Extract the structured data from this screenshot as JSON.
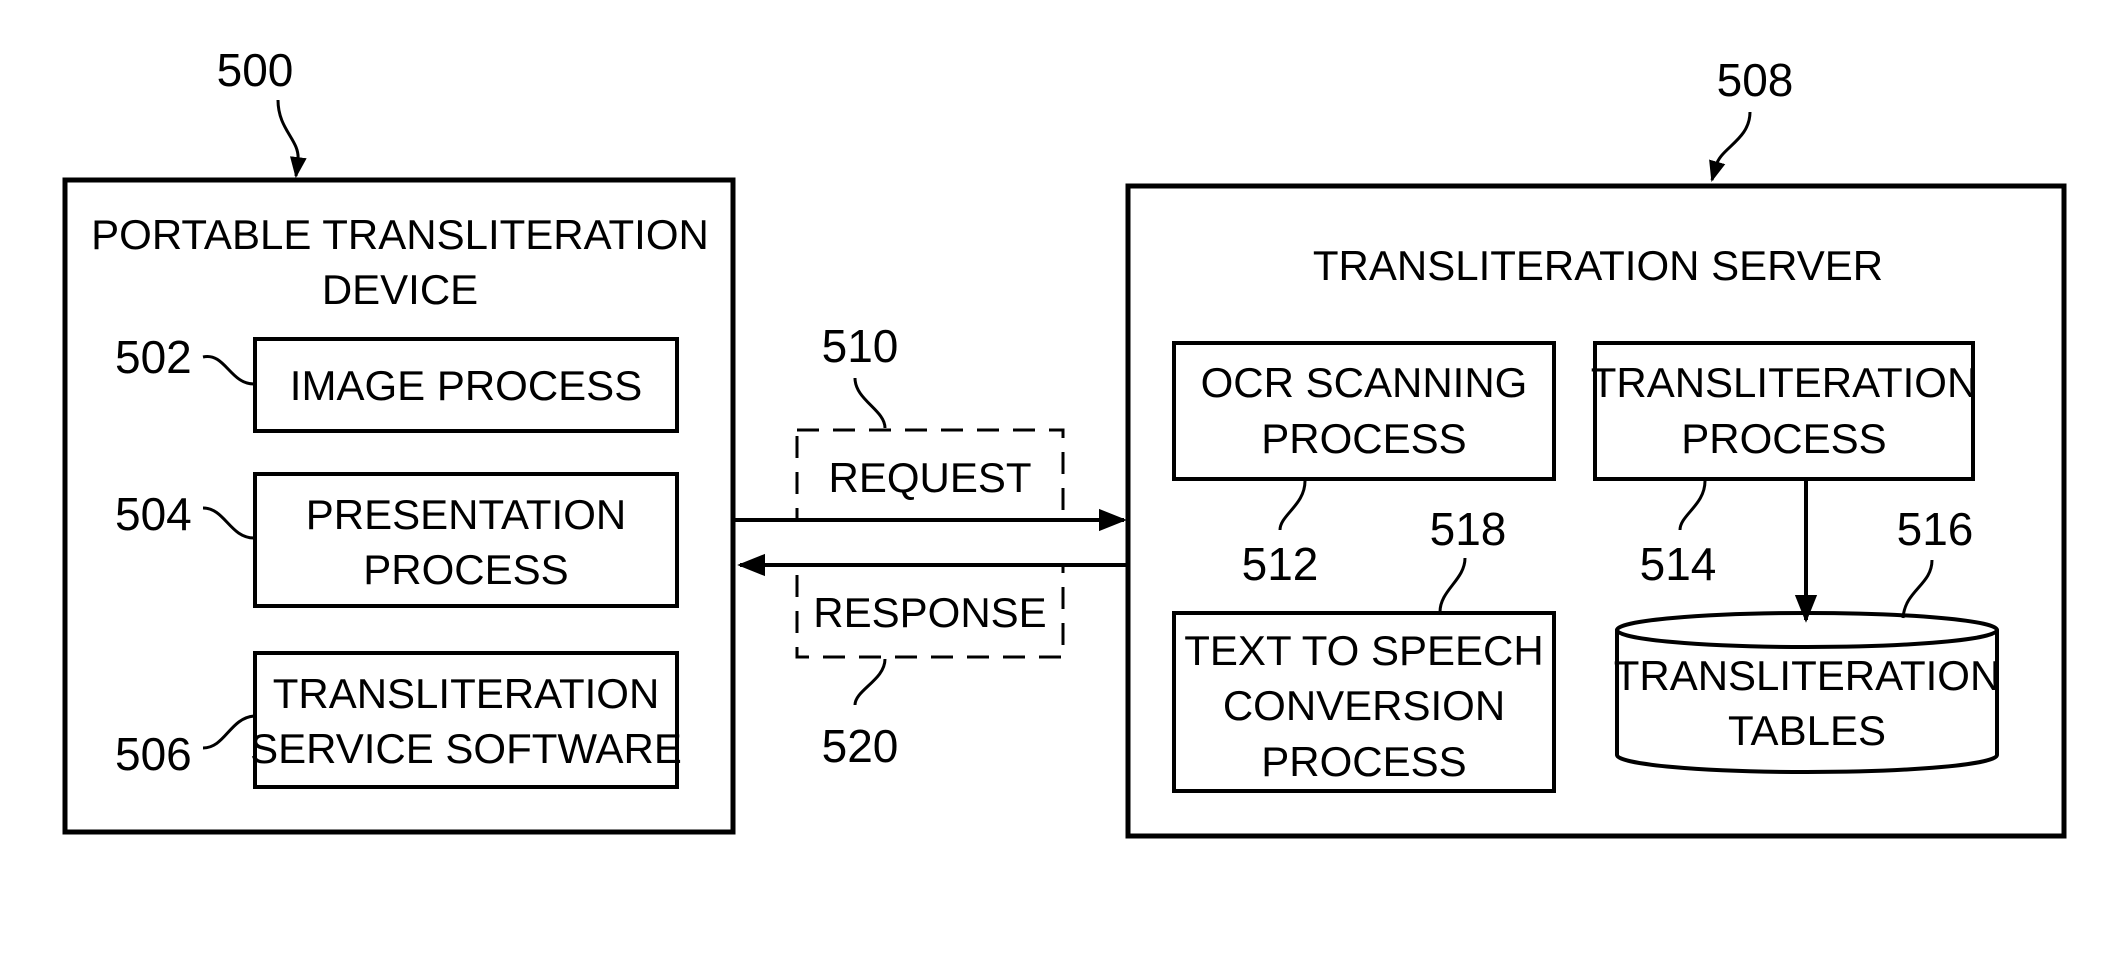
{
  "figure": {
    "device": {
      "ref": "500",
      "title_lines": [
        "PORTABLE TRANSLITERATION",
        "DEVICE"
      ],
      "components": [
        {
          "ref": "502",
          "lines": [
            "IMAGE PROCESS"
          ]
        },
        {
          "ref": "504",
          "lines": [
            "PRESENTATION",
            "PROCESS"
          ]
        },
        {
          "ref": "506",
          "lines": [
            "TRANSLITERATION",
            "SERVICE SOFTWARE"
          ]
        }
      ]
    },
    "messages": {
      "request": {
        "ref": "510",
        "label": "REQUEST"
      },
      "response": {
        "ref": "520",
        "label": "RESPONSE"
      }
    },
    "server": {
      "ref": "508",
      "title": "TRANSLITERATION SERVER",
      "components": [
        {
          "ref": "512",
          "lines": [
            "OCR SCANNING",
            "PROCESS"
          ]
        },
        {
          "ref": "514",
          "lines": [
            "TRANSLITERATION",
            "PROCESS"
          ]
        },
        {
          "ref": "518",
          "lines": [
            "TEXT TO SPEECH",
            "CONVERSION",
            "PROCESS"
          ]
        },
        {
          "ref": "516",
          "lines": [
            "TRANSLITERATION",
            "TABLES"
          ]
        }
      ]
    }
  }
}
